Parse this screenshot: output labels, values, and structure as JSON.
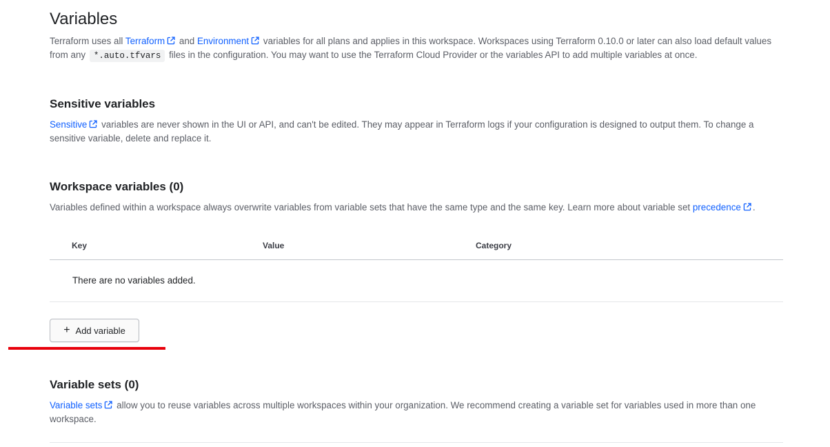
{
  "page": {
    "title": "Variables",
    "intro": {
      "t1": "Terraform uses all ",
      "link_terraform": "Terraform",
      "t2": " and ",
      "link_environment": "Environment",
      "t3": " variables for all plans and applies in this workspace. Workspaces using Terraform 0.10.0 or later can also load default values from any ",
      "code": "*.auto.tfvars",
      "t4": " files in the configuration. You may want to use the Terraform Cloud Provider or the variables API to add multiple variables at once."
    }
  },
  "sensitive": {
    "heading": "Sensitive variables",
    "link": "Sensitive",
    "text": " variables are never shown in the UI or API, and can't be edited. They may appear in Terraform logs if your configuration is designed to output them. To change a sensitive variable, delete and replace it."
  },
  "workspace": {
    "heading": "Workspace variables (0)",
    "text": "Variables defined within a workspace always overwrite variables from variable sets that have the same type and the same key. Learn more about variable set ",
    "link": "precedence",
    "text_end": ".",
    "table": {
      "columns": [
        "Key",
        "Value",
        "Category"
      ],
      "empty_message": "There are no variables added."
    },
    "add_button": {
      "icon": "plus-icon",
      "label": "Add variable"
    }
  },
  "variable_sets": {
    "heading": "Variable sets (0)",
    "link": "Variable sets",
    "text": " allow you to reuse variables across multiple workspaces within your organization. We recommend creating a variable set for variables used in more than one workspace."
  },
  "colors": {
    "link": "#1060ff",
    "annotation": "#e8000b",
    "heading": "#1f2124",
    "body_text": "#5b5e66"
  }
}
